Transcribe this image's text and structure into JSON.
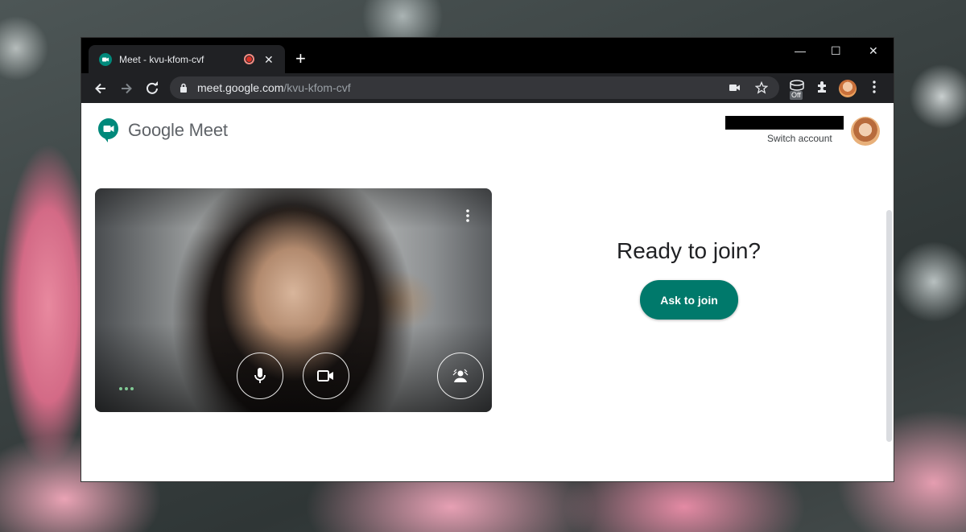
{
  "tab": {
    "title": "Meet - kvu-kfom-cvf",
    "close": "✕"
  },
  "new_tab": "+",
  "window_controls": {
    "minimize": "—",
    "maximize": "☐",
    "close": "✕"
  },
  "address": {
    "host": "meet.google.com",
    "path": "/kvu-kfom-cvf"
  },
  "extension_badge": "Off",
  "header": {
    "logo_text": "Google Meet",
    "switch_account": "Switch account"
  },
  "join": {
    "heading": "Ready to join?",
    "button": "Ask to join"
  },
  "colors": {
    "accent": "#00796b",
    "recording": "#d93025"
  }
}
